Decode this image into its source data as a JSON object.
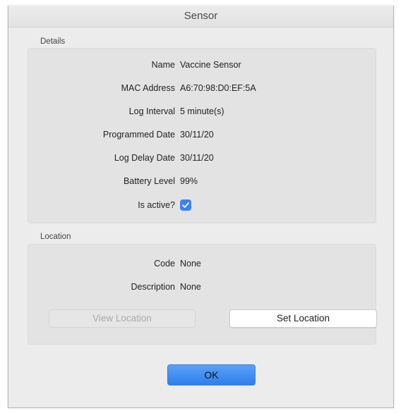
{
  "window": {
    "title": "Sensor"
  },
  "details": {
    "title": "Details",
    "rows": [
      {
        "label": "Name",
        "value": "Vaccine Sensor"
      },
      {
        "label": "MAC Address",
        "value": "A6:70:98:D0:EF:5A"
      },
      {
        "label": "Log Interval",
        "value": "5 minute(s)"
      },
      {
        "label": "Programmed Date",
        "value": "30/11/20"
      },
      {
        "label": "Log Delay Date",
        "value": "30/11/20"
      },
      {
        "label": "Battery Level",
        "value": "99%"
      }
    ],
    "is_active_label": "Is active?",
    "is_active_checked": true
  },
  "location": {
    "title": "Location",
    "rows": [
      {
        "label": "Code",
        "value": "None"
      },
      {
        "label": "Description",
        "value": "None"
      }
    ],
    "view_button": "View Location",
    "set_button": "Set Location"
  },
  "footer": {
    "ok_button": "OK"
  },
  "colors": {
    "accent": "#3b82f6",
    "window_bg": "#ececec",
    "group_bg": "#e3e3e3"
  }
}
